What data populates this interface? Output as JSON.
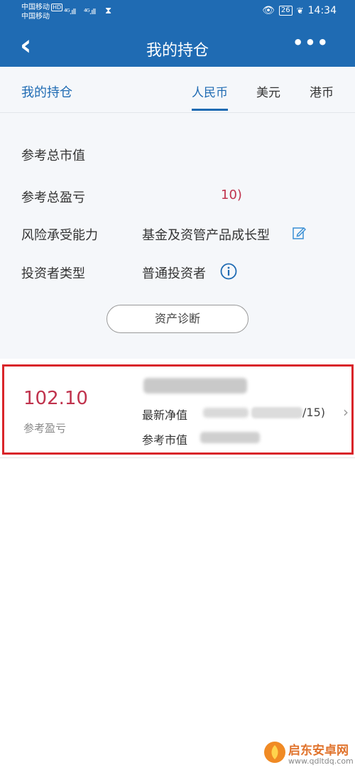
{
  "status_bar": {
    "carrier1": "中国移动",
    "carrier2": "中国移动",
    "hd": "HD",
    "signal1": "⁴ᴳ.ıll",
    "signal2": "⁴ᴳ.ıll",
    "battery": "26",
    "time": "14:34"
  },
  "header": {
    "title": "我的持仓"
  },
  "tabs": {
    "heading": "我的持仓",
    "items": [
      "人民币",
      "美元",
      "港币"
    ],
    "active": "人民币"
  },
  "summary": {
    "total_market_value_label": "参考总市值",
    "total_pnl_label": "参考总盈亏",
    "total_pnl_value": "10)",
    "risk_label": "风险承受能力",
    "risk_value": "基金及资管产品成长型",
    "investor_type_label": "投资者类型",
    "investor_type_value": "普通投资者",
    "diagnose_button": "资产诊断"
  },
  "holding": {
    "profit": "102.10",
    "profit_label": "参考盈亏",
    "nav_label": "最新净值",
    "nav_date_tail": "/15)",
    "market_value_label": "参考市值"
  },
  "watermark": {
    "title": "启东安卓网",
    "url": "www.qdltdq.com"
  },
  "colors": {
    "header": "#1f6bb3",
    "accent": "#1f6bb3",
    "profit": "#c0334d",
    "highlight_border": "#d9252a"
  }
}
